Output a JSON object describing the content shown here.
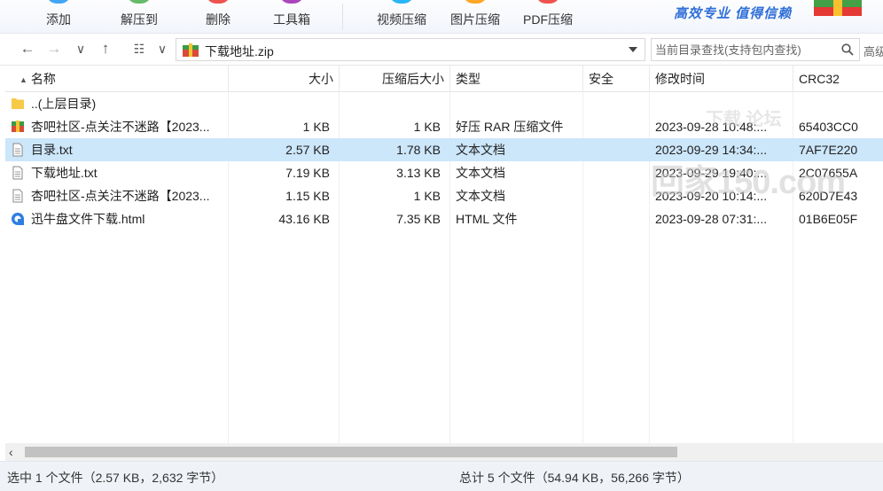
{
  "toolbar": {
    "buttons": [
      {
        "label": "添加",
        "color": "#42a5f5"
      },
      {
        "label": "解压到",
        "color": "#66bb6a"
      },
      {
        "label": "删除",
        "color": "#ef5350"
      },
      {
        "label": "工具箱",
        "color": "#ab47bc"
      },
      {
        "label": "视频压缩",
        "color": "#29b6f6"
      },
      {
        "label": "图片压缩",
        "color": "#ffa726"
      },
      {
        "label": "PDF压缩",
        "color": "#ef5350"
      }
    ],
    "slogan": "高效专业  值得信赖"
  },
  "nav": {
    "path": "下载地址.zip",
    "search_placeholder": "当前目录查找(支持包内查找)",
    "advanced_label": "高级"
  },
  "columns": {
    "name": "名称",
    "size": "大小",
    "packed": "压缩后大小",
    "type": "类型",
    "security": "安全",
    "modified": "修改时间",
    "crc": "CRC32"
  },
  "files": [
    {
      "icon": "folder-icon",
      "name": "..(上层目录)",
      "size": "",
      "packed": "",
      "type": "",
      "modified": "",
      "crc": ""
    },
    {
      "icon": "rar-archive-icon",
      "name": "杏吧社区-点关注不迷路【2023...",
      "size": "1 KB",
      "packed": "1 KB",
      "type": "好压 RAR 压缩文件",
      "modified": "2023-09-28 10:48:...",
      "crc": "65403CC0"
    },
    {
      "icon": "text-file-icon",
      "name": "目录.txt",
      "size": "2.57 KB",
      "packed": "1.78 KB",
      "type": "文本文档",
      "modified": "2023-09-29 14:34:...",
      "crc": "7AF7E220"
    },
    {
      "icon": "text-file-icon",
      "name": "下载地址.txt",
      "size": "7.19 KB",
      "packed": "3.13 KB",
      "type": "文本文档",
      "modified": "2023-09-29 19:40:...",
      "crc": "2C07655A"
    },
    {
      "icon": "text-file-icon",
      "name": "杏吧社区-点关注不迷路【2023...",
      "size": "1.15 KB",
      "packed": "1 KB",
      "type": "文本文档",
      "modified": "2023-09-20 10:14:...",
      "crc": "620D7E43"
    },
    {
      "icon": "html-file-icon",
      "name": "迅牛盘文件下载.html",
      "size": "43.16 KB",
      "packed": "7.35 KB",
      "type": "HTML 文件",
      "modified": "2023-09-28 07:31:...",
      "crc": "01B6E05F"
    }
  ],
  "selected_index": 2,
  "watermark": {
    "main": "回家150.com",
    "sub": "下载 论坛"
  },
  "status": {
    "left": "选中 1 个文件（2.57 KB，2,632 字节）",
    "right": "总计 5 个文件（54.94 KB，56,266 字节）"
  },
  "colors": {
    "selection": "#cce6fa",
    "accent": "#2f6fd8",
    "status_bar": "#eff3f8"
  }
}
